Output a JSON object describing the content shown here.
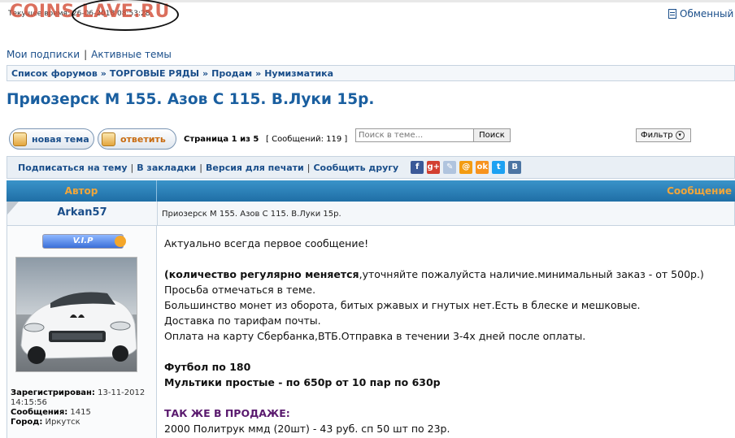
{
  "header": {
    "current_time_label": "Текущее время:",
    "current_time_value": "26-06-2018 08:53:28",
    "watermark": "COINS.LAVE.RU",
    "exchange_link": "Обменный"
  },
  "user_links": {
    "subscriptions": "Мои подписки",
    "separator": "|",
    "active_topics": "Активные темы"
  },
  "breadcrumb": {
    "items": [
      "Список форумов",
      "ТОРГОВЫЕ РЯДЫ",
      "Продам",
      "Нумизматика"
    ],
    "separator": "»"
  },
  "topic": {
    "title": "Приозерск М 155. Азов С 115. В.Луки 15р."
  },
  "toolbar": {
    "new_topic_label": "новая тема",
    "reply_label": "ответить",
    "page_label_prefix": "Страница",
    "page_current": "1",
    "page_of": "из",
    "page_total": "5",
    "messages_count": "[ Сообщений: 119 ]",
    "search_placeholder": "Поиск в теме...",
    "search_button": "Поиск",
    "filter_label": "Фильтр"
  },
  "actions": {
    "subscribe": "Подписаться на тему",
    "bookmarks": "В закладки",
    "print_version": "Версия для печати",
    "tell_friend": "Сообщить другу",
    "separator": "|",
    "social_icons": [
      {
        "name": "facebook-icon",
        "glyph": "f",
        "color": "#3b5998"
      },
      {
        "name": "google-plus-icon",
        "glyph": "g+",
        "color": "#d23f31"
      },
      {
        "name": "livejournal-icon",
        "glyph": "✎",
        "color": "#b0c4de"
      },
      {
        "name": "mail-ru-icon",
        "glyph": "@",
        "color": "#f39c12"
      },
      {
        "name": "odnoklassniki-icon",
        "glyph": "ok",
        "color": "#f7931e"
      },
      {
        "name": "twitter-icon",
        "glyph": "t",
        "color": "#1da1f2"
      },
      {
        "name": "vkontakte-icon",
        "glyph": "B",
        "color": "#4c75a3"
      }
    ]
  },
  "table": {
    "author_header": "Автор",
    "message_header": "Сообщение"
  },
  "post": {
    "author": "Arkan57",
    "badge": "V.I.P",
    "subject": "Приозерск М 155. Азов С 115. В.Луки 15р.",
    "registered_label": "Зарегистрирован:",
    "registered_value": "13-11-2012",
    "registered_time": "14:15:56",
    "messages_label": "Сообщения:",
    "messages_value": "1415",
    "city_label": "Город:",
    "city_value": "Иркутск",
    "body": {
      "line1": "Актуально всегда первое сообщение!",
      "line2_bold": "(количество регулярно меняется",
      "line2_rest": ",уточняйте пожалуйста наличие.минимальный заказ - от 500р.)",
      "line3": "Просьба отмечаться в теме.",
      "line4": "Большинство монет из оборота, битых ржавых и гнутых нет.Есть в блеске и мешковые.",
      "line5": "Доставка по тарифам почты.",
      "line6": "Оплата на карту Сбербанка,ВТБ.Отправка в течении 3-4х дней после оплаты.",
      "line7": "Футбол по 180",
      "line8": "Мультики простые - по 650р от 10 пар по 630р",
      "line9": "ТАК ЖЕ В ПРОДАЖЕ:",
      "line10": "2000 Политрук ммд (20шт) - 43 руб. сп 50 шт по 23р."
    }
  }
}
